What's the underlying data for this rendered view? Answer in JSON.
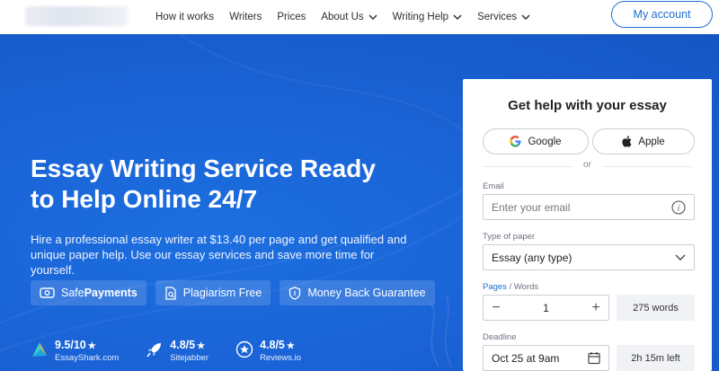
{
  "nav": {
    "items": [
      {
        "label": "How it works",
        "dropdown": false
      },
      {
        "label": "Writers",
        "dropdown": false
      },
      {
        "label": "Prices",
        "dropdown": false
      },
      {
        "label": "About Us",
        "dropdown": true
      },
      {
        "label": "Writing Help",
        "dropdown": true
      },
      {
        "label": "Services",
        "dropdown": true
      }
    ],
    "account_label": "My account"
  },
  "hero": {
    "title_line1": "Essay Writing Service Ready",
    "title_line2": "to Help Online 24/7",
    "description": "Hire a professional essay writer at $13.40 per page and get qualified and unique paper help. Use our essay services and save more time for yourself.",
    "badges": [
      {
        "icon": "safepayments-icon",
        "label_plain": "Safe",
        "label_bold": "Payments"
      },
      {
        "icon": "plagiarism-icon",
        "label_plain": "Plagiarism Free",
        "label_bold": ""
      },
      {
        "icon": "shield-icon",
        "label_plain": "Money Back Guarantee",
        "label_bold": ""
      }
    ],
    "ratings": [
      {
        "icon": "essayshark-logo-icon",
        "score": "9.5/10",
        "source": "EssayShark.com"
      },
      {
        "icon": "rocket-icon",
        "score": "4.8/5",
        "source": "Sitejabber"
      },
      {
        "icon": "star-badge-icon",
        "score": "4.8/5",
        "source": "Reviews.io"
      }
    ]
  },
  "form": {
    "title": "Get help with your essay",
    "google_label": "Google",
    "apple_label": "Apple",
    "or_label": "or",
    "email_label": "Email",
    "email_placeholder": "Enter your email",
    "paper_type_label": "Type of paper",
    "paper_type_value": "Essay (any type)",
    "pages_label": "Pages",
    "words_label": " / Words",
    "pages_value": "1",
    "words_value": "275 words",
    "deadline_label": "Deadline",
    "deadline_value": "Oct 25 at 9am",
    "time_left": "2h 15m left"
  },
  "colors": {
    "accent": "#1f6fd1",
    "hero_bg": "#1a63d6"
  }
}
